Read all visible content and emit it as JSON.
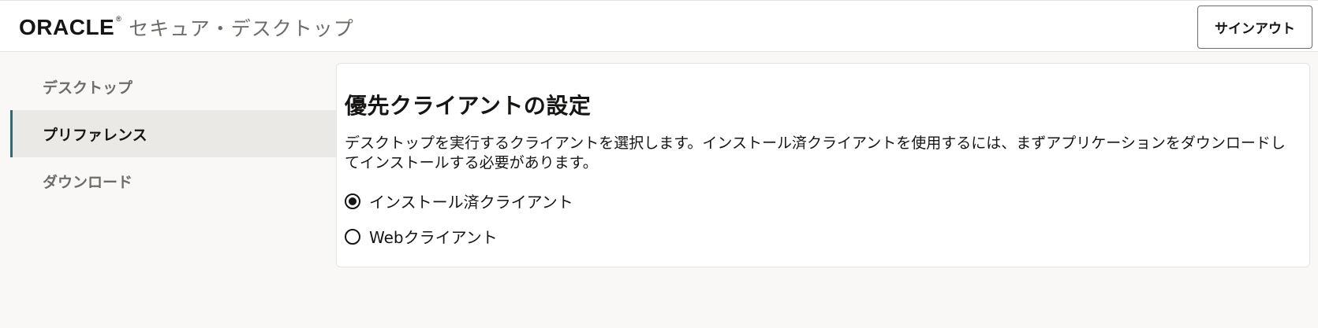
{
  "header": {
    "logo_text": "ORACLE",
    "logo_mark": "®",
    "product_name": "セキュア・デスクトップ",
    "signout_label": "サインアウト"
  },
  "sidebar": {
    "items": [
      {
        "label": "デスクトップ",
        "active": false
      },
      {
        "label": "プリファレンス",
        "active": true
      },
      {
        "label": "ダウンロード",
        "active": false
      }
    ]
  },
  "main": {
    "title": "優先クライアントの設定",
    "description": "デスクトップを実行するクライアントを選択します。インストール済クライアントを使用するには、まずアプリケーションをダウンロードしてインストールする必要があります。",
    "options": [
      {
        "label": "インストール済クライアント",
        "selected": true
      },
      {
        "label": "Webクライアント",
        "selected": false
      }
    ]
  },
  "colors": {
    "accent": "#2b6a7f",
    "background": "#f9f8f6",
    "active_nav_bg": "#ebe9e6"
  }
}
